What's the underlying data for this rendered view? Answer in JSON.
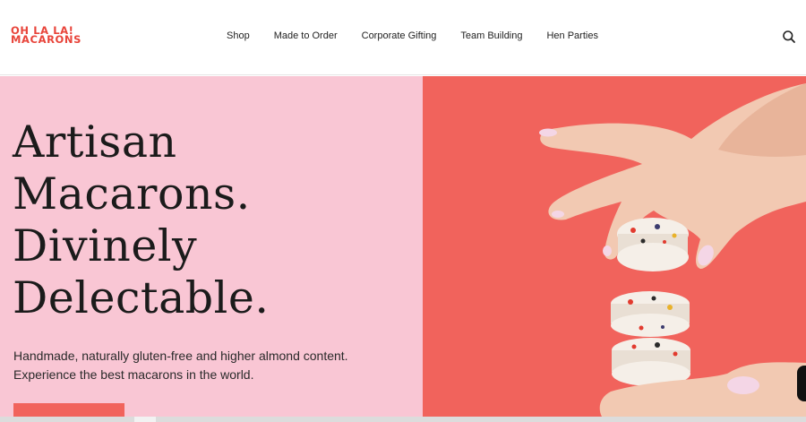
{
  "brand": {
    "logo_line1": "OH LA LA!",
    "logo_line2": "MACARONS",
    "logo_color": "#e8443a"
  },
  "nav": {
    "items": [
      {
        "label": "Shop"
      },
      {
        "label": "Made to Order"
      },
      {
        "label": "Corporate Gifting"
      },
      {
        "label": "Team Building"
      },
      {
        "label": "Hen Parties"
      }
    ],
    "search_icon": "search-icon"
  },
  "hero": {
    "headline_lines": [
      "Artisan",
      "Macarons.",
      "Divinely",
      "Delectable."
    ],
    "subtext_lines": [
      "Handmade, naturally gluten-free and higher almond content.",
      "Experience the best macarons in the world."
    ],
    "left_bg": "#f9c6d4",
    "right_bg": "#f1635c",
    "cta_color": "#f1635c"
  }
}
